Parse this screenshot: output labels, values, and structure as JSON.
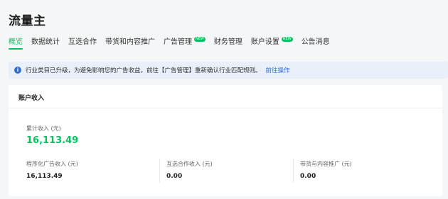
{
  "header": {
    "title": "流量主"
  },
  "tabs": [
    {
      "label": "概览",
      "active": true,
      "badge": ""
    },
    {
      "label": "数据统计",
      "active": false,
      "badge": ""
    },
    {
      "label": "互选合作",
      "active": false,
      "badge": ""
    },
    {
      "label": "带货和内容推广",
      "active": false,
      "badge": ""
    },
    {
      "label": "广告管理",
      "active": false,
      "badge": "NEW"
    },
    {
      "label": "财务管理",
      "active": false,
      "badge": ""
    },
    {
      "label": "账户设置",
      "active": false,
      "badge": "NEW"
    },
    {
      "label": "公告消息",
      "active": false,
      "badge": ""
    }
  ],
  "notice": {
    "icon": "info-icon",
    "text": "行业类目已升级，为避免影响您的广告收益，前往【广告管理】重新确认行业匹配规则。",
    "link": "前往操作"
  },
  "income": {
    "title": "账户收入",
    "total_label": "累计收入 (元)",
    "total_value": "16,113.49",
    "stats": [
      {
        "label": "程序化广告收入 (元)",
        "value": "16,113.49"
      },
      {
        "label": "互选合作收入 (元)",
        "value": "0.00"
      },
      {
        "label": "带货与内容推广 (元)",
        "value": "0.00"
      }
    ]
  },
  "colors": {
    "accent": "#07c160",
    "link": "#2f6fd6",
    "notice_bg": "#eaf0fa"
  }
}
